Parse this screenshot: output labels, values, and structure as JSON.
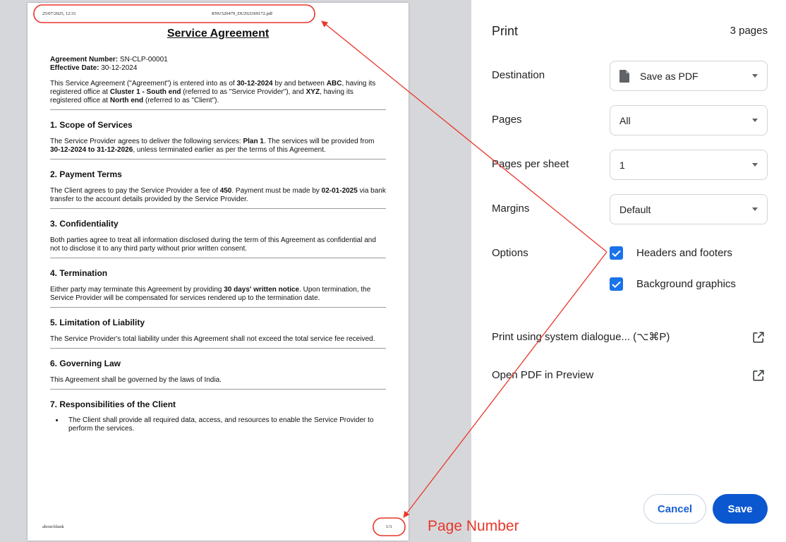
{
  "preview": {
    "header": {
      "date": "25/07/2025, 12:31",
      "filename": "RNU520479_DUZ63369172.pdf"
    },
    "footer": {
      "url": "about:blank",
      "page": "1/3"
    }
  },
  "document": {
    "title": "Service Agreement",
    "agreement_number_label": "Agreement Number:",
    "agreement_number": "SN-CLP-00001",
    "effective_date_label": "Effective Date:",
    "effective_date": "30-12-2024",
    "intro": {
      "t1": "This Service Agreement (\"Agreement\") is entered into as of ",
      "b1": "30-12-2024",
      "t2": " by and between ",
      "b2": "ABC",
      "t3": ", having its registered office at ",
      "b3": "Cluster 1 - South end",
      "t4": " (referred to as \"Service Provider\"), and ",
      "b4": "XYZ",
      "t5": ", having its registered office at ",
      "b5": "North end",
      "t6": " (referred to as \"Client\")."
    },
    "s1": {
      "heading": "1. Scope of Services",
      "t1": "The Service Provider agrees to deliver the following services: ",
      "b1": "Plan 1",
      "t2": ". The services will be provided from ",
      "b2": "30-12-2024 to 31-12-2026",
      "t3": ", unless terminated earlier as per the terms of this Agreement."
    },
    "s2": {
      "heading": "2. Payment Terms",
      "t1": "The Client agrees to pay the Service Provider a fee of ",
      "b1": "450",
      "t2": ". Payment must be made by ",
      "b2": "02-01-2025",
      "t3": " via bank transfer to the account details provided by the Service Provider."
    },
    "s3": {
      "heading": "3. Confidentiality",
      "text": "Both parties agree to treat all information disclosed during the term of this Agreement as confidential and not to disclose it to any third party without prior written consent."
    },
    "s4": {
      "heading": "4. Termination",
      "t1": "Either party may terminate this Agreement by providing ",
      "b1": "30 days' written notice",
      "t2": ". Upon termination, the Service Provider will be compensated for services rendered up to the termination date."
    },
    "s5": {
      "heading": "5. Limitation of Liability",
      "text": "The Service Provider's total liability under this Agreement shall not exceed the total service fee received."
    },
    "s6": {
      "heading": "6. Governing Law",
      "text": "This Agreement shall be governed by the laws of India."
    },
    "s7": {
      "heading": "7. Responsibilities of the Client",
      "bullet": "The Client shall provide all required data, access, and resources to enable the Service Provider to perform the services."
    }
  },
  "panel": {
    "title": "Print",
    "page_count": "3 pages",
    "destination": {
      "label": "Destination",
      "value": "Save as PDF"
    },
    "pages": {
      "label": "Pages",
      "value": "All"
    },
    "pages_per_sheet": {
      "label": "Pages per sheet",
      "value": "1"
    },
    "margins": {
      "label": "Margins",
      "value": "Default"
    },
    "options": {
      "label": "Options",
      "headers_footers": "Headers and footers",
      "headers_footers_checked": true,
      "background_graphics": "Background graphics",
      "background_graphics_checked": true
    },
    "system_dialog": "Print using system dialogue... (⌥⌘P)",
    "open_preview": "Open PDF in Preview",
    "cancel": "Cancel",
    "save": "Save"
  },
  "annotation": {
    "label": "Page Number",
    "color": "#e8372a"
  },
  "colors": {
    "accent": "#1a73e8",
    "save_button": "#0b57d0",
    "preview_background": "#d6d7da"
  }
}
